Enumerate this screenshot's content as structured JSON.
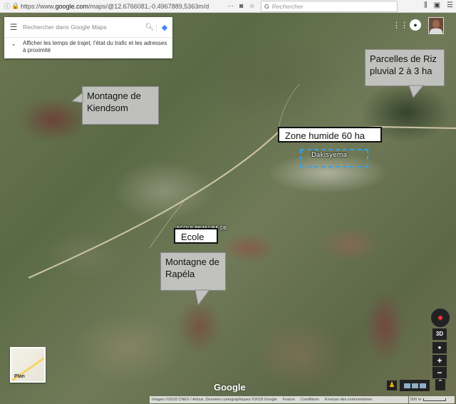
{
  "browser": {
    "url_prefix": "https://www.",
    "url_host": "google.com",
    "url_rest": "/maps/@12.6766081,-0.4967889,5363m/d",
    "search_placeholder": "Rechercher",
    "more_icon": "more-dots-icon",
    "pocket_icon": "pocket-icon",
    "star_icon": "star-icon"
  },
  "maps_search": {
    "placeholder": "Rechercher dans Google Maps",
    "hint": "Afficher les temps de trajet, l'état du trafic et les adresses à proximité"
  },
  "callouts": {
    "kiendsom": "Montagne de Kiendsom",
    "riz": "Parcelles de Riz pluvial 2 à 3 ha",
    "rapela": "Montagne de Rapéla"
  },
  "labels": {
    "zone_humide": "Zone humide 60 ha",
    "ecole": "Ecole",
    "place_dakisyema": "Dakisyema",
    "place_ecole_primaire": "ECOLE PRIMAIRE DE RAPELA"
  },
  "controls": {
    "three_d": "3D",
    "zoom_in": "+",
    "zoom_out": "−",
    "plan_label": "Plan"
  },
  "google_logo": "Google",
  "attribution": {
    "imagery": "Images ©2018 CNES / Airbus, Données cartographiques ©2018 Google",
    "country": "France",
    "conditions": "Conditions",
    "feedback": "Envoyer des commentaires",
    "scale": "500 m"
  },
  "colors": {
    "dashed_outline": "#39a0e0",
    "road": "#d9cfb0"
  }
}
